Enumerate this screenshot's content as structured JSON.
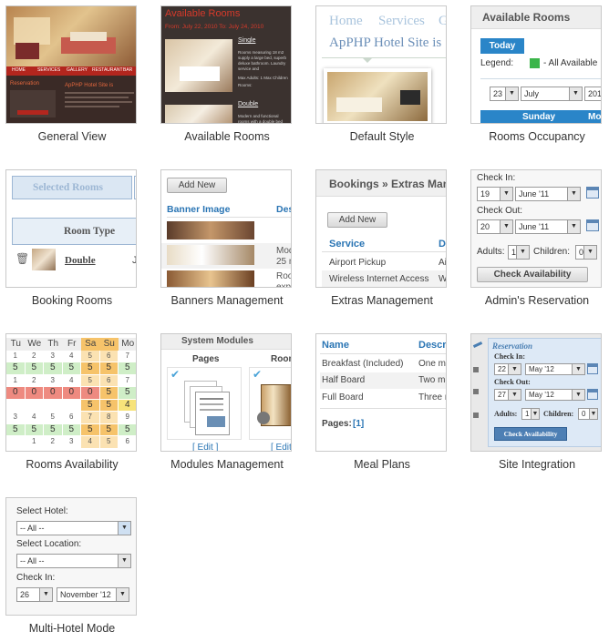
{
  "tiles": [
    {
      "caption": "General View"
    },
    {
      "caption": "Available Rooms"
    },
    {
      "caption": "Default Style"
    },
    {
      "caption": "Rooms Occupancy"
    },
    {
      "caption": "Booking Rooms"
    },
    {
      "caption": "Banners Management"
    },
    {
      "caption": "Extras Management"
    },
    {
      "caption": "Admin's Reservation"
    },
    {
      "caption": "Rooms Availability"
    },
    {
      "caption": "Modules Management"
    },
    {
      "caption": "Meal Plans"
    },
    {
      "caption": "Site Integration"
    },
    {
      "caption": "Multi-Hotel Mode"
    }
  ],
  "general_view": {
    "nav": [
      "HOME",
      "SERVICES",
      "GALLERY",
      "RESTAURANT",
      "BAR"
    ],
    "side_title": "Reservation",
    "main_title": "ApPHP Hotel Site is"
  },
  "available_rooms": {
    "title": "Available Rooms",
    "dates": "From: July 22, 2010 To: July 24, 2010",
    "room1": "Single",
    "room1_desc": "Rooms measuring 18 m2 supply a large bed, superb deluxe bathroom. Laundry service and",
    "room1_adults": "Max Adults: 1  Max Children",
    "room1_rooms": "Rooms:",
    "room2": "Double",
    "room2_desc": "Modern and functional rooms with a double bed"
  },
  "default_style": {
    "nav": [
      "Home",
      "Services",
      "G"
    ],
    "site_title": "ApPHP Hotel Site is"
  },
  "rooms_occupancy": {
    "title": "Available Rooms",
    "today": "Today",
    "legend_label": "Legend:",
    "legend_text": "- All Available",
    "day": "23",
    "month": "July",
    "year": "201",
    "weekday1": "Sunday",
    "weekday2": "Mo",
    "accent": "#2a85c8",
    "legend_color": "#3bb54a"
  },
  "booking_rooms": {
    "tab": "Selected Rooms",
    "header": "Room Type",
    "room": "Double",
    "extra": "J"
  },
  "banners": {
    "add": "Add New",
    "col1": "Banner Image",
    "col2": "Des",
    "rows": [
      "Mod",
      "25 m",
      "Roo",
      "expe"
    ]
  },
  "extras": {
    "title": "Bookings » Extras Man",
    "add": "Add New",
    "col1": "Service",
    "col2": "De",
    "rows": [
      [
        "Airport Pickup",
        "Ai"
      ],
      [
        "Wireless Internet Access",
        "W"
      ]
    ]
  },
  "admin_res": {
    "check_in": "Check In:",
    "in_day": "19",
    "in_month": "June '11",
    "check_out": "Check Out:",
    "out_day": "20",
    "out_month": "June '11",
    "adults": "Adults:",
    "adults_val": "1",
    "children": "Children:",
    "children_val": "0",
    "button": "Check Availability"
  },
  "availability": {
    "days": [
      "Tu",
      "We",
      "Th",
      "Fr",
      "Sa",
      "Su",
      "Mo",
      "T"
    ],
    "rows": [
      {
        "cells": [
          "1",
          "2",
          "3",
          "4",
          "5",
          "6",
          "7",
          ""
        ],
        "kind": "num"
      },
      {
        "cells": [
          "5",
          "5",
          "5",
          "5",
          "5",
          "5",
          "5",
          "5"
        ],
        "kind": "avail"
      },
      {
        "cells": [
          "1",
          "2",
          "3",
          "4",
          "5",
          "6",
          "7",
          ""
        ],
        "kind": "num"
      },
      {
        "cells": [
          "0",
          "0",
          "0",
          "0",
          "0",
          "5",
          "5",
          "0"
        ],
        "kind": "mixed"
      },
      {
        "cells": [
          "",
          "",
          "",
          "",
          "5",
          "5",
          "4",
          "4"
        ],
        "kind": "partial"
      },
      {
        "cells": [
          "3",
          "4",
          "5",
          "6",
          "7",
          "8",
          "9",
          ""
        ],
        "kind": "num"
      },
      {
        "cells": [
          "5",
          "5",
          "5",
          "5",
          "5",
          "5",
          "5",
          "5"
        ],
        "kind": "avail"
      },
      {
        "cells": [
          "",
          "1",
          "2",
          "3",
          "4",
          "5",
          "6",
          ""
        ],
        "kind": "num"
      }
    ]
  },
  "modules": {
    "title": "System Modules",
    "col1": "Pages",
    "col2": "Room",
    "edit": "[ Edit ]",
    "edit2": "[ Edit"
  },
  "meal_plans": {
    "col1": "Name",
    "col2": "Descri",
    "rows": [
      [
        "Breakfast (Included)",
        "One me"
      ],
      [
        "Half Board",
        "Two me"
      ],
      [
        "Full Board",
        "Three m"
      ]
    ],
    "pages_label": "Pages:",
    "page": "[1]"
  },
  "site_integration": {
    "title": "Reservation",
    "check_in": "Check In:",
    "in_day": "22",
    "in_month": "May '12",
    "check_out": "Check Out:",
    "out_day": "27",
    "out_month": "May '12",
    "adults": "Adults:",
    "adults_val": "1",
    "children": "Children:",
    "children_val": "0",
    "button": "Check Availability"
  },
  "multi_hotel": {
    "hotel_label": "Select Hotel:",
    "hotel_val": "-- All --",
    "location_label": "Select Location:",
    "location_val": "-- All --",
    "check_in": "Check In:",
    "day": "26",
    "month": "November '12"
  }
}
